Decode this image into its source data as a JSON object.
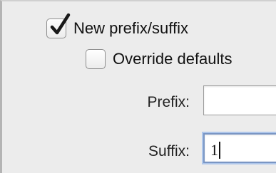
{
  "options": {
    "new_prefix_suffix": {
      "label": "New prefix/suffix",
      "checked": true
    },
    "override_defaults": {
      "label": "Override defaults",
      "checked": false
    }
  },
  "fields": {
    "prefix": {
      "label": "Prefix:",
      "value": ""
    },
    "suffix": {
      "label": "Suffix:",
      "value": "1"
    }
  },
  "colors": {
    "checkmark": "#1a1a1a",
    "focus_ring": "#aec6ea"
  }
}
